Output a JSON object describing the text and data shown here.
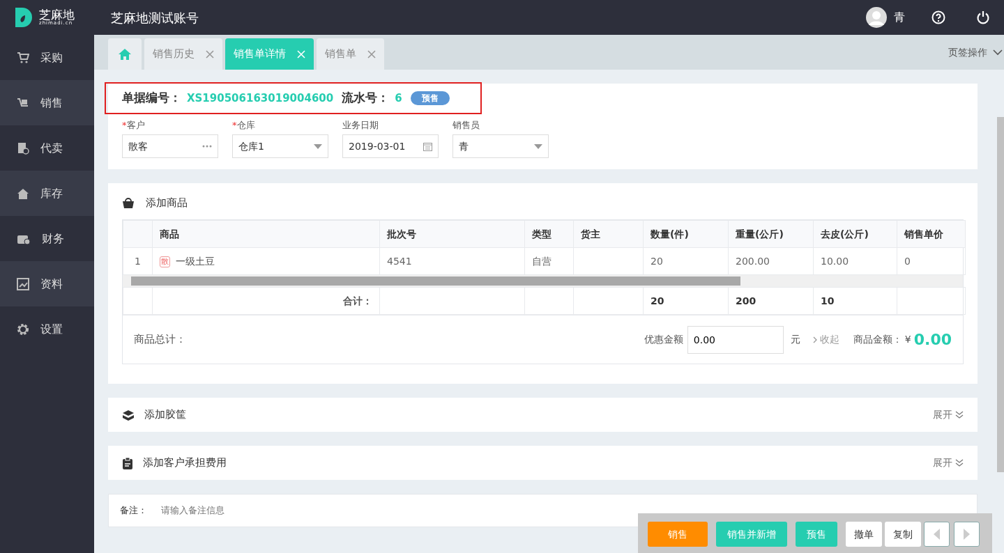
{
  "header": {
    "logo_text": "芝麻地",
    "logo_sub": "zhimadi.cn",
    "account": "芝麻地测试账号",
    "user": "青"
  },
  "sidebar": {
    "items": [
      {
        "label": "采购"
      },
      {
        "label": "销售"
      },
      {
        "label": "代卖"
      },
      {
        "label": "库存"
      },
      {
        "label": "财务"
      },
      {
        "label": "资料"
      },
      {
        "label": "设置"
      }
    ]
  },
  "tabs": [
    {
      "kind": "home",
      "selected": false
    },
    {
      "kind": "page",
      "label": "销售历史",
      "selected": false
    },
    {
      "kind": "page",
      "label": "销售单详情",
      "selected": true
    },
    {
      "kind": "page",
      "label": "销售单",
      "selected": false
    }
  ],
  "tab_ops": "页签操作",
  "order": {
    "no_label": "单据编号：",
    "no": "XS190506163019004600",
    "serial_label": "流水号：",
    "serial": "6",
    "badge": "预售",
    "fields": [
      {
        "mark": "*",
        "label": "客户",
        "value": "散客",
        "kind": "more"
      },
      {
        "mark": "*",
        "label": "仓库",
        "value": "仓库1",
        "kind": "select"
      },
      {
        "label": "业务日期",
        "value": "2019-03-01",
        "kind": "date"
      },
      {
        "label": "销售员",
        "value": "青",
        "kind": "select"
      }
    ]
  },
  "goods": {
    "title": "添加商品",
    "table": {
      "columns": [
        "",
        "商品",
        "批次号",
        "类型",
        "货主",
        "数量(件)",
        "重量(公斤)",
        "去皮(公斤)",
        "销售单价"
      ],
      "rows": [
        {
          "cells": [
            "1",
            "一级土豆",
            "4541",
            "自营",
            "",
            "20",
            "200.00",
            "10.00",
            "0"
          ],
          "tag": "散"
        }
      ],
      "total_label": "合计：",
      "totals": {
        "quantity": "20",
        "weight": "200",
        "tare": "10"
      }
    },
    "summary_label": "商品总计：",
    "discount_label": "优惠金额",
    "discount": "0.00",
    "unit": "元",
    "collapse": "收起",
    "amount_label": "商品金额：",
    "currency": "¥",
    "amount": "0.00"
  },
  "sections": [
    {
      "title": "添加胶筐",
      "toggle": "展开"
    },
    {
      "title": "添加客户承担费用",
      "toggle": "展开"
    }
  ],
  "remark": {
    "label": "备注：",
    "placeholder": "请输入备注信息"
  },
  "actions": [
    {
      "label": "销售",
      "kind": "warning"
    },
    {
      "label": "销售并新增",
      "kind": "primary"
    },
    {
      "label": "预售",
      "kind": "primary"
    },
    {
      "label": "撤单",
      "kind": "plain"
    },
    {
      "label": "复制",
      "kind": "plain"
    },
    {
      "kind": "prev"
    },
    {
      "kind": "next"
    }
  ]
}
